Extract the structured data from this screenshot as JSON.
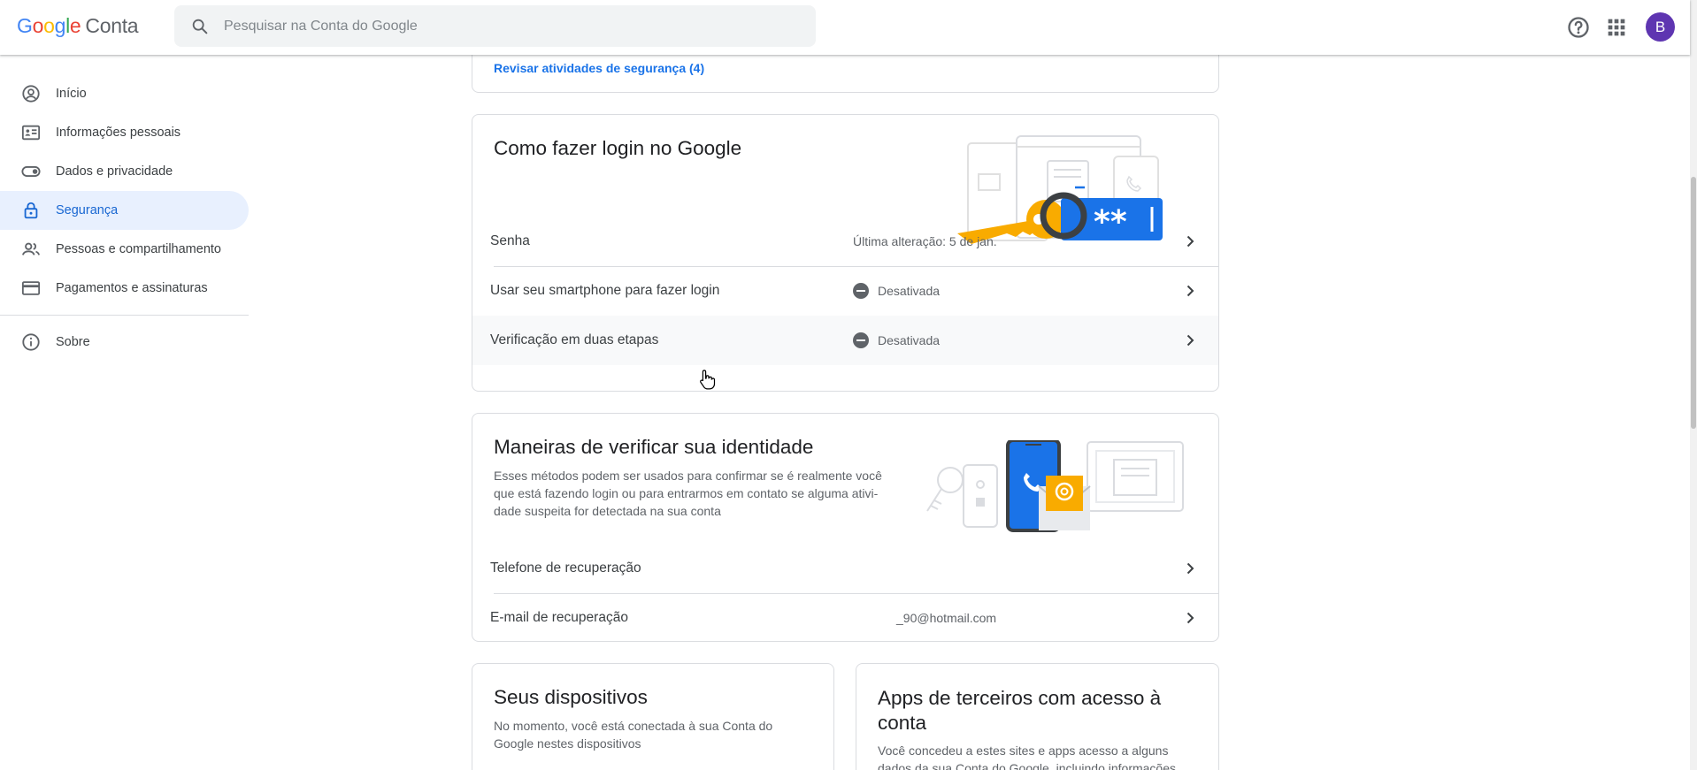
{
  "header": {
    "logo_letters": [
      "G",
      "o",
      "o",
      "g",
      "l",
      "e"
    ],
    "logo_suffix": "Conta",
    "search_placeholder": "Pesquisar na Conta do Google",
    "avatar_letter": "B"
  },
  "sidebar": {
    "items": [
      {
        "label": "Início",
        "icon": "account-circle-icon"
      },
      {
        "label": "Informações pessoais",
        "icon": "id-card-icon"
      },
      {
        "label": "Dados e privacidade",
        "icon": "toggle-icon"
      },
      {
        "label": "Segurança",
        "icon": "lock-icon",
        "active": true
      },
      {
        "label": "Pessoas e compartilhamento",
        "icon": "people-icon"
      },
      {
        "label": "Pagamentos e assinaturas",
        "icon": "credit-card-icon"
      }
    ],
    "footer_item": {
      "label": "Sobre",
      "icon": "info-icon"
    }
  },
  "security_activity": {
    "review_link": "Revisar atividades de segurança (4)"
  },
  "login_card": {
    "title": "Como fazer login no Google",
    "rows": [
      {
        "label": "Senha",
        "value": "Última alteração: 5 de jan.",
        "status_icon": false
      },
      {
        "label": "Usar seu smartphone para fazer login",
        "value": "Desativada",
        "status_icon": true
      },
      {
        "label": "Verificação em duas etapas",
        "value": "Desativada",
        "status_icon": true
      }
    ],
    "password_mask": "**"
  },
  "identity_card": {
    "title": "Maneiras de verificar sua identidade",
    "description_lines": [
      "Esses métodos podem ser usados para confirmar se é realmente você",
      "que está fazendo login ou para entrarmos em contato se alguma ativi-",
      "dade suspeita for detectada na sua conta"
    ],
    "rows": [
      {
        "label": "Telefone de recuperação",
        "value": ""
      },
      {
        "label": "E-mail de recuperação",
        "value": "_90@hotmail.com"
      }
    ]
  },
  "devices_card": {
    "title": "Seus dispositivos",
    "description_lines": [
      "No momento, você está conectada à sua Conta do",
      "Google nestes dispositivos"
    ]
  },
  "third_party_card": {
    "title_lines": [
      "Apps de terceiros com acesso à",
      "conta"
    ],
    "description_lines": [
      "Você concedeu a estes sites e apps acesso a alguns",
      "dados da sua Conta do Google, incluindo informações"
    ]
  },
  "colors": {
    "accent": "#1a73e8",
    "active_bg": "#e8f0fe",
    "avatar": "#5e35b1",
    "key_yellow": "#f9ab00",
    "password_blue": "#1a73e8"
  }
}
